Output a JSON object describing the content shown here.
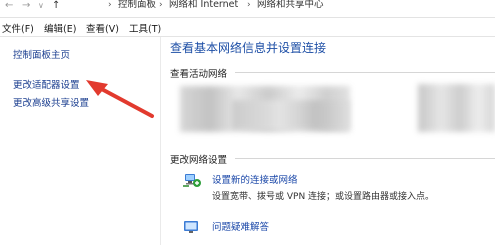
{
  "address_bar": {
    "back_glyph": "←",
    "forward_glyph": "→",
    "dropdown_glyph": "∨",
    "up_glyph": "↑",
    "breadcrumbs": [
      "控制面板",
      "网络和 Internet",
      "网络和共享中心"
    ],
    "separator": "›"
  },
  "menu": {
    "items": [
      "文件(F)",
      "编辑(E)",
      "查看(V)",
      "工具(T)"
    ]
  },
  "sidebar": {
    "items": [
      {
        "label": "控制面板主页"
      },
      {
        "label": "更改适配器设置"
      },
      {
        "label": "更改高级共享设置"
      }
    ]
  },
  "main": {
    "title": "查看基本网络信息并设置连接",
    "active_networks_label": "查看活动网络",
    "change_settings_label": "更改网络设置",
    "tasks": [
      {
        "link": "设置新的连接或网络",
        "description": "设置宽带、拨号或 VPN 连接；或设置路由器或接入点。",
        "icon": "network-setup-icon"
      },
      {
        "link": "问题疑难解答",
        "description": "",
        "icon": "troubleshoot-icon"
      }
    ]
  },
  "colors": {
    "link": "#1a47a8",
    "title": "#1e4fa6",
    "annotation_arrow": "#e23a2e"
  }
}
